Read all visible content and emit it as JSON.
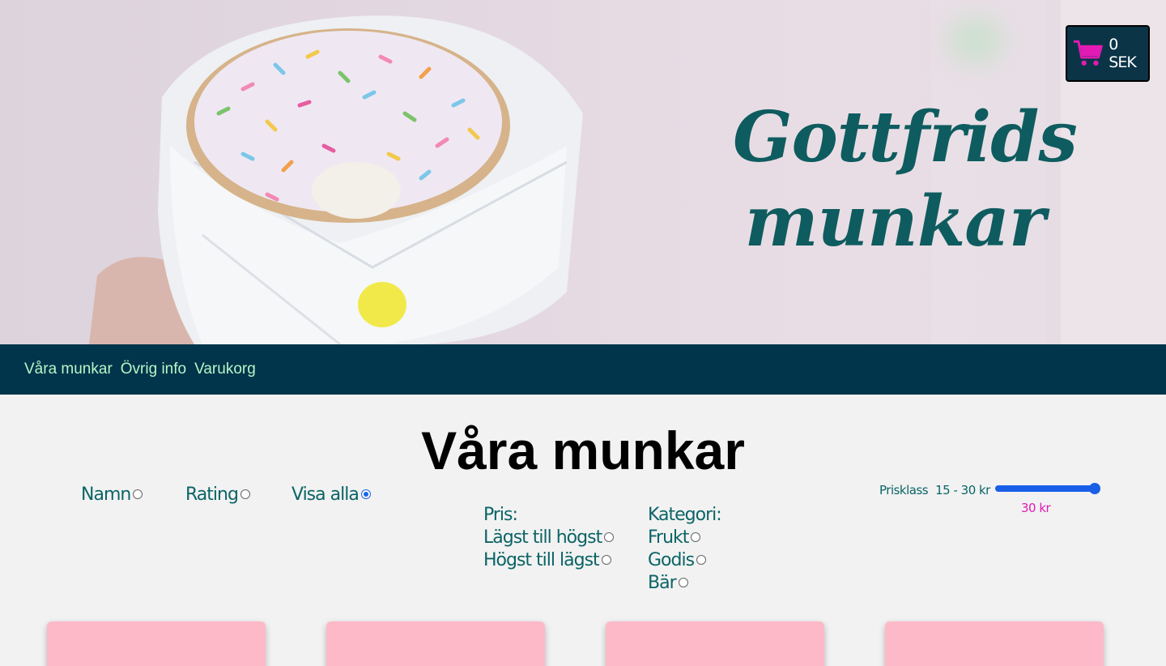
{
  "hero": {
    "brand_line1": "Gottfrids",
    "brand_line2": "munkar"
  },
  "cart": {
    "icon": "shopping-cart-icon",
    "amount": "0 SEK"
  },
  "nav": {
    "items": [
      {
        "label": "Våra munkar"
      },
      {
        "label": "Övrig info"
      },
      {
        "label": "Varukorg"
      }
    ]
  },
  "main": {
    "title": "Våra munkar",
    "sort": {
      "name": "Namn",
      "rating": "Rating",
      "show_all": "Visa alla",
      "selected": "show_all"
    },
    "price_sort": {
      "heading": "Pris:",
      "low_high": "Lägst till högst",
      "high_low": "Högst till lägst"
    },
    "category": {
      "heading": "Kategori:",
      "items": [
        "Frukt",
        "Godis",
        "Bär"
      ]
    },
    "price_range": {
      "label": "Prisklass",
      "range": "15 - 30 kr",
      "value": "30 kr",
      "slider_fraction": 1.0
    },
    "cards_count": 4
  },
  "colors": {
    "nav_bg": "#01354b",
    "nav_text": "#b9f5c7",
    "teal": "#0c6466",
    "accent_pink": "#e21bb4",
    "card_pink": "#fdb9c8"
  }
}
